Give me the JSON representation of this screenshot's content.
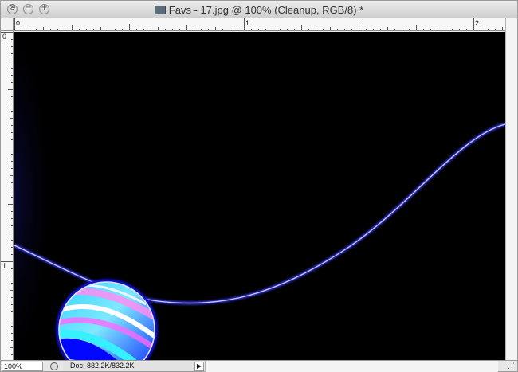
{
  "window": {
    "title": "Favs - 17.jpg @ 100% (Cleanup, RGB/8) *",
    "title_icon": "document-image-icon"
  },
  "titlebar": {
    "buttons": [
      {
        "name": "close",
        "glyph": "⊗"
      },
      {
        "name": "minimize",
        "glyph": "−"
      },
      {
        "name": "zoom",
        "glyph": "+"
      }
    ]
  },
  "rulers": {
    "top_labels": [
      "0",
      "1",
      "2"
    ],
    "left_labels": [
      "0",
      "1"
    ]
  },
  "canvas": {
    "background": "#000000",
    "curve_color": "#6a6cff",
    "ball_colors": [
      "#1a1aff",
      "#2ee6ff",
      "#ff66ff",
      "#ffffff"
    ]
  },
  "status": {
    "zoom": "100%",
    "doc": "Doc: 832.2K/832.2K",
    "arrow": "▶",
    "resize_grip": "⋰"
  }
}
